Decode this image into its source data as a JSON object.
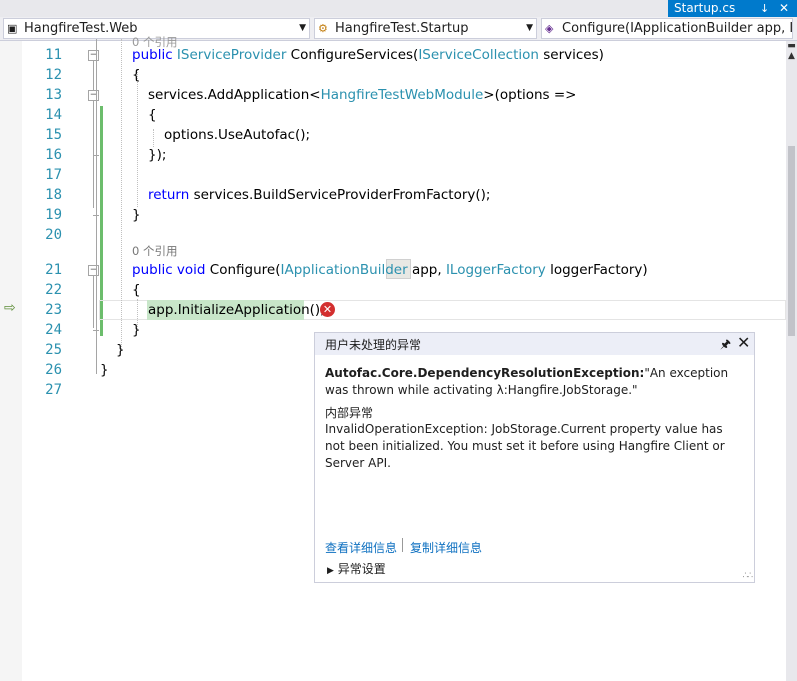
{
  "document_tab": {
    "title": "Startup.cs",
    "pin_icon": "pin-icon",
    "close_icon": "close-icon"
  },
  "nav": {
    "project": "HangfireTest.Web",
    "class": "HangfireTest.Startup",
    "member": "Configure(IApplicationBuilder app, ILog"
  },
  "code": {
    "ref_hint": "0 个引用",
    "lines": [
      11,
      12,
      13,
      14,
      15,
      16,
      17,
      18,
      19,
      20,
      21,
      22,
      23,
      24,
      25,
      26,
      27
    ]
  },
  "exception": {
    "title": "用户未处理的异常",
    "type": "Autofac.Core.DependencyResolutionException:",
    "message": "\"An exception was thrown while activating λ:Hangfire.JobStorage.\"",
    "inner_header": "内部异常",
    "inner_message": "InvalidOperationException: JobStorage.Current property value has not been initialized. You must set it before using Hangfire Client or Server API.",
    "link_view": "查看详细信息",
    "link_copy": "复制详细信息",
    "settings": "异常设置"
  },
  "colors": {
    "accent": "#007acc",
    "keyword": "#0000ff",
    "type": "#2b91af",
    "changed": "#6cbd6c",
    "error": "#d32f2f"
  }
}
